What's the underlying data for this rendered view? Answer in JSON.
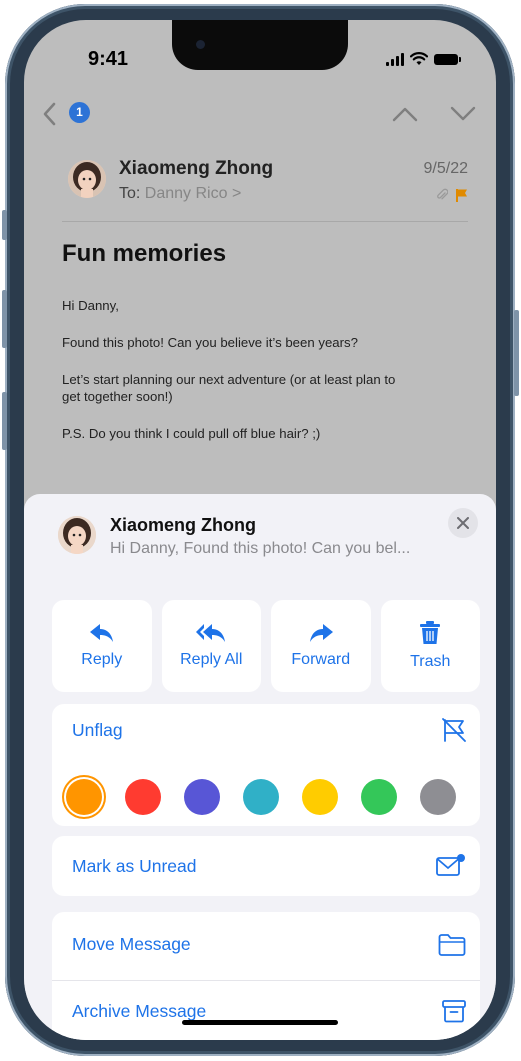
{
  "status_bar": {
    "time": "9:41"
  },
  "nav": {
    "unread_count": "1"
  },
  "message": {
    "sender": "Xiaomeng Zhong",
    "to_label": "To:",
    "to_name": "Danny Rico >",
    "date": "9/5/22",
    "subject": "Fun memories",
    "body": [
      "Hi Danny,",
      "Found this photo! Can you believe it’s been years?",
      "Let’s start planning our next adventure (or at least plan to get together soon!)",
      "P.S. Do you think I could pull off blue hair? ;)"
    ]
  },
  "sheet": {
    "sender": "Xiaomeng Zhong",
    "preview": "Hi Danny, Found this photo! Can you bel...",
    "actions": [
      {
        "label": "Reply",
        "icon": "reply-icon"
      },
      {
        "label": "Reply All",
        "icon": "reply-all-icon"
      },
      {
        "label": "Forward",
        "icon": "forward-icon"
      },
      {
        "label": "Trash",
        "icon": "trash-icon"
      }
    ],
    "unflag": "Unflag",
    "flag_colors": [
      "#ff9500",
      "#ff3b30",
      "#5856d6",
      "#30b0c7",
      "#ffcc00",
      "#34c759",
      "#8e8e93"
    ],
    "mark_unread": "Mark as Unread",
    "move_message": "Move Message",
    "archive_message": "Archive Message"
  },
  "colors": {
    "accent": "#1e73e8",
    "flag": "#ff9500"
  }
}
